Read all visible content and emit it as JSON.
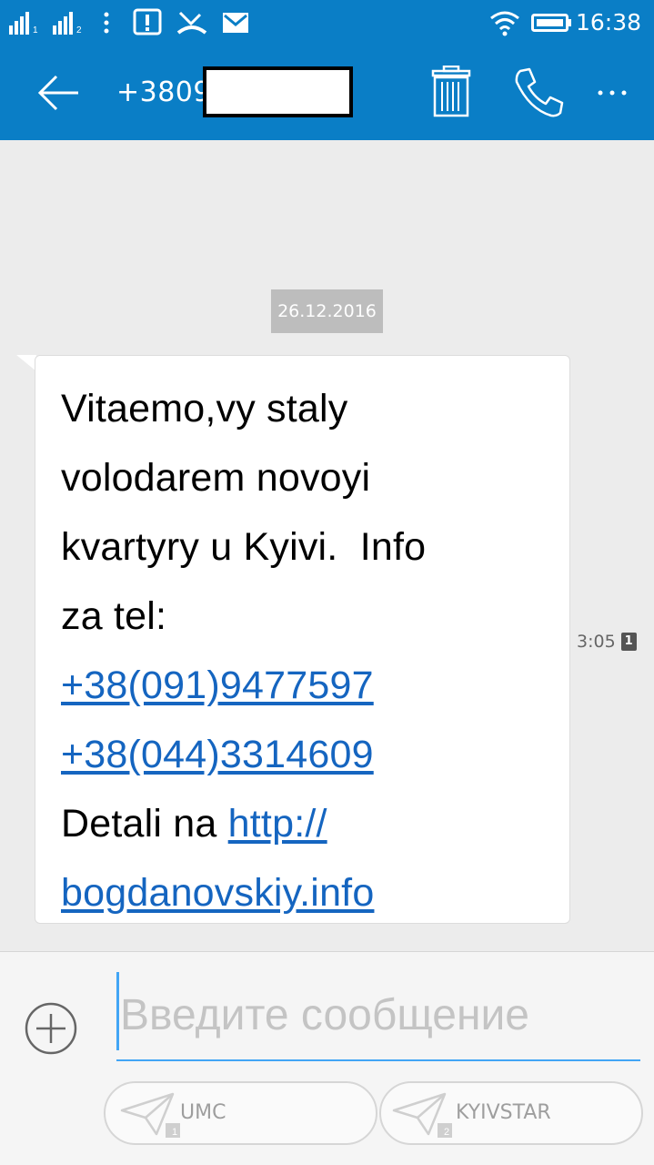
{
  "status_bar": {
    "sim1_label": "1",
    "sim2_label": "2",
    "time": "16:38",
    "icons": [
      "signal-sim1-icon",
      "signal-sim2-icon",
      "more-vert-icon",
      "alert-notification-icon",
      "missed-call-icon",
      "gmail-icon",
      "wifi-icon",
      "battery-icon"
    ]
  },
  "action_bar": {
    "title": "+38090",
    "icons": [
      "back-arrow-icon",
      "trash-icon",
      "phone-icon",
      "more-horiz-icon"
    ]
  },
  "conversation": {
    "date": "26.12.2016",
    "message": {
      "lines": [
        "Vitaemo,vy staly",
        "volodarem novoyi",
        "kvartyry u Kyivi.  Info",
        "za tel:"
      ],
      "phone1": "+38(091)9477597",
      "phone2": "+38(044)3314609",
      "detail_prefix": "Detali na ",
      "link_part1": "http://",
      "link_part2": "bogdanovskiy.info",
      "time": "3:05",
      "sim": "1"
    }
  },
  "compose": {
    "placeholder": "Введите сообщение",
    "send_sim1_label": "UMC",
    "send_sim1_badge": "1",
    "send_sim2_label": "KYIVSTAR",
    "send_sim2_badge": "2"
  },
  "colors": {
    "accent": "#0a7ec6",
    "link": "#1565c0",
    "input_underline": "#42a5f5",
    "date_chip": "#bdbdbd"
  }
}
